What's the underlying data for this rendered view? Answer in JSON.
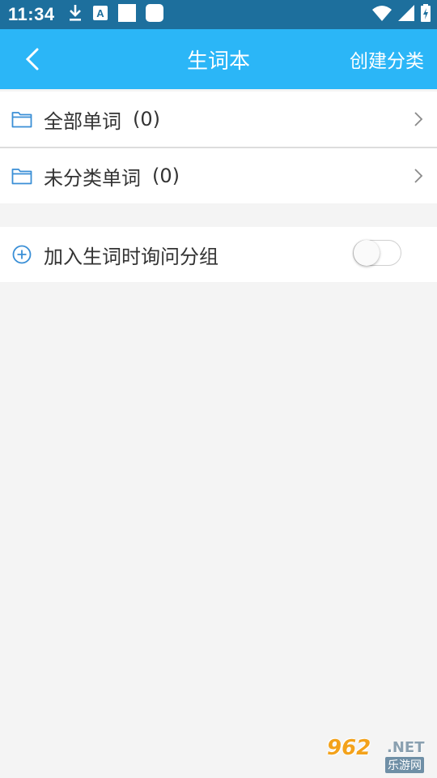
{
  "status_bar": {
    "time": "11:34",
    "icons_left": [
      "download-icon",
      "a-badge-icon",
      "square-icon",
      "rounded-square-icon"
    ],
    "icons_right": [
      "wifi-icon",
      "signal-icon",
      "battery-charging-icon"
    ]
  },
  "app_bar": {
    "title": "生词本",
    "action": "创建分类",
    "background": "#2bb6f7"
  },
  "categories": [
    {
      "label": "全部单词",
      "count": "(0)"
    },
    {
      "label": "未分类单词",
      "count": "(0)"
    }
  ],
  "settings": {
    "ask_group_label": "加入生词时询问分组",
    "ask_group_enabled": false
  },
  "watermark": {
    "brand": "962",
    "domain": ".NET",
    "name": "乐游网"
  },
  "colors": {
    "accent": "#2bb6f7",
    "status_bar": "#1d6f9d",
    "icon_blue": "#3a8fd6",
    "background": "#f4f4f4"
  }
}
